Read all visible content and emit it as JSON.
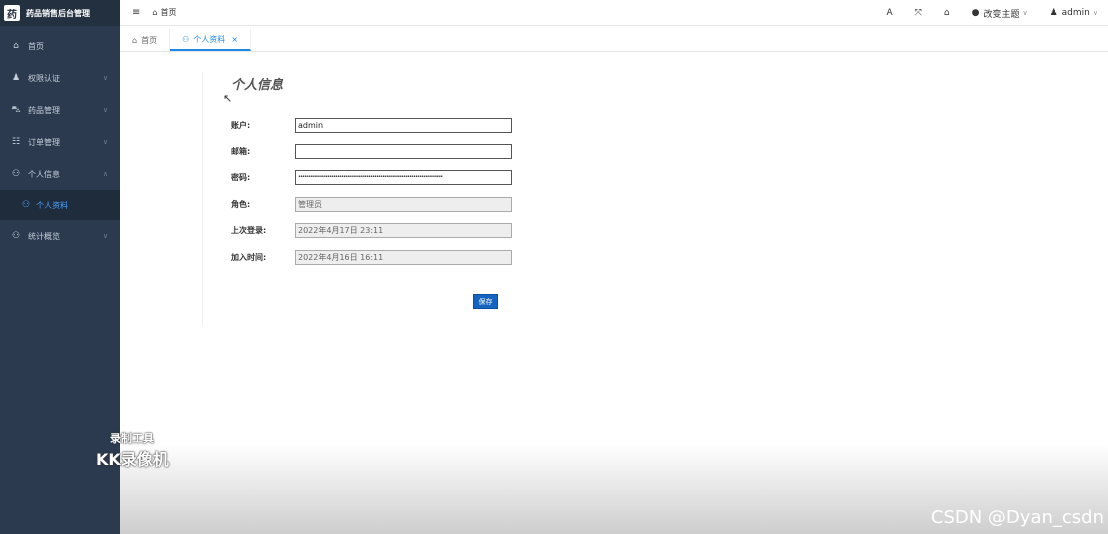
{
  "app": {
    "title": "药品销售后台管理",
    "logo_glyph": "药"
  },
  "sidebar": {
    "items": [
      {
        "label": "首页",
        "icon": "home-icon",
        "glyph": "⌂"
      },
      {
        "label": "权限认证",
        "icon": "user-key-icon",
        "glyph": "♟"
      },
      {
        "label": "药品管理",
        "icon": "car-icon",
        "glyph": "⛍"
      },
      {
        "label": "订单管理",
        "icon": "table-icon",
        "glyph": "☷"
      },
      {
        "label": "个人信息",
        "icon": "users-icon",
        "glyph": "⚇"
      }
    ],
    "sub_item": {
      "label": "个人资料",
      "glyph": "⚇"
    },
    "last_item": {
      "label": "统计概览",
      "glyph": "⚇"
    }
  },
  "header": {
    "menu_glyph": "≡",
    "crumb": {
      "glyph": "⌂",
      "label": "首页"
    },
    "font_glyph": "A",
    "fullscreen_glyph": "⤧",
    "home_glyph": "⌂",
    "theme": {
      "glyph": "●",
      "label": "改变主题",
      "caret": "∨"
    },
    "user": {
      "glyph": "♟",
      "label": "admin",
      "caret": "∨"
    }
  },
  "tabs": [
    {
      "label": "首页",
      "glyph": "⌂"
    },
    {
      "label": "个人资料",
      "glyph": "⚇",
      "close": "×"
    }
  ],
  "form": {
    "title": "个人信息",
    "cursor": "↖",
    "fields": [
      {
        "label": "账户:",
        "value": "admin"
      },
      {
        "label": "邮箱:",
        "value": ""
      },
      {
        "label": "密码:",
        "value": "••••••••••••••••••••••••••••••••••••••••••••••••••••••••••••••••••••••••••"
      },
      {
        "label": "角色:",
        "value": "管理员"
      },
      {
        "label": "上次登录:",
        "value": "2022年4月17日 23:11"
      },
      {
        "label": "加入时间:",
        "value": "2022年4月16日 16:11"
      }
    ],
    "save_label": "保存"
  },
  "watermarks": {
    "line1": "录制工具",
    "line2": "KK录像机",
    "csdn": "CSDN @Dyan_csdn"
  }
}
